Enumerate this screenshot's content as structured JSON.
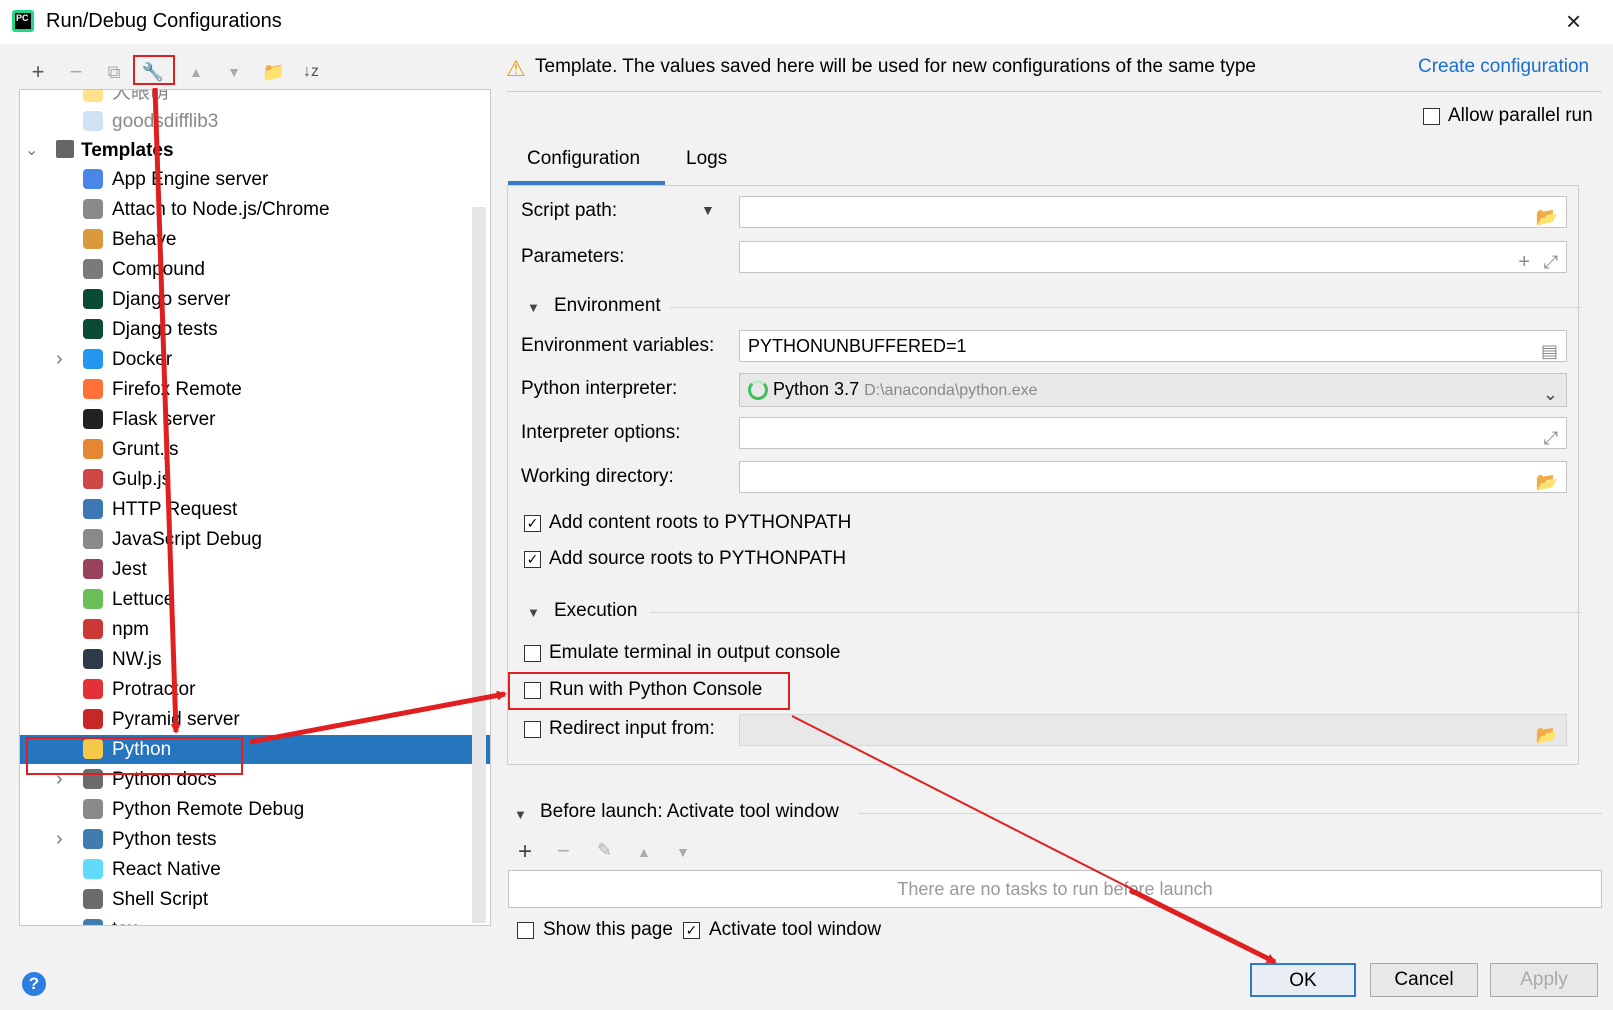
{
  "window": {
    "title": "Run/Debug Configurations",
    "close_icon": "×"
  },
  "left_toolbar": {
    "add": "+",
    "remove": "−",
    "copy": "⧉",
    "edit_defaults": "🔧",
    "move_up": "▲",
    "move_down": "▼",
    "folder": "📁",
    "sort": "↓z"
  },
  "tree": {
    "items_above": [
      "大眼萌",
      "goodsdifflib3"
    ],
    "templates_label": "Templates",
    "items": [
      {
        "label": "App Engine server",
        "color": "#4a86e8"
      },
      {
        "label": "Attach to Node.js/Chrome",
        "color": "#8a8a8a"
      },
      {
        "label": "Behave",
        "color": "#d89a3a"
      },
      {
        "label": "Compound",
        "color": "#7a7a7a"
      },
      {
        "label": "Django server",
        "color": "#0c4b33"
      },
      {
        "label": "Django tests",
        "color": "#0c4b33"
      },
      {
        "label": "Docker",
        "color": "#2496ed",
        "expandable": true
      },
      {
        "label": "Firefox Remote",
        "color": "#ff7139"
      },
      {
        "label": "Flask server",
        "color": "#222222"
      },
      {
        "label": "Grunt.js",
        "color": "#e48632"
      },
      {
        "label": "Gulp.js",
        "color": "#cf4647"
      },
      {
        "label": "HTTP Request",
        "color": "#3c78b4"
      },
      {
        "label": "JavaScript Debug",
        "color": "#8a8a8a"
      },
      {
        "label": "Jest",
        "color": "#99425b"
      },
      {
        "label": "Lettuce",
        "color": "#6bbf59"
      },
      {
        "label": "npm",
        "color": "#cb3837"
      },
      {
        "label": "NW.js",
        "color": "#2f3a4b"
      },
      {
        "label": "Protractor",
        "color": "#e23237"
      },
      {
        "label": "Pyramid server",
        "color": "#c62828"
      },
      {
        "label": "Python",
        "color": "#f7c948",
        "selected": true
      },
      {
        "label": "Python docs",
        "color": "#6b6b6b",
        "expandable": true
      },
      {
        "label": "Python Remote Debug",
        "color": "#8a8a8a"
      },
      {
        "label": "Python tests",
        "color": "#3f7cb0",
        "expandable": true
      },
      {
        "label": "React Native",
        "color": "#61dafb"
      },
      {
        "label": "Shell Script",
        "color": "#6b6b6b"
      },
      {
        "label": "tox",
        "color": "#3f7cb0"
      }
    ]
  },
  "header": {
    "warning_icon": "⚠",
    "notice": "Template. The values saved here will be used for new configurations of the same type",
    "create_link": "Create configuration",
    "allow_parallel": "Allow parallel run"
  },
  "tabs": [
    "Configuration",
    "Logs"
  ],
  "config": {
    "script_path_label": "Script path:",
    "parameters_label": "Parameters:",
    "environment_section": "Environment",
    "env_vars_label": "Environment variables:",
    "env_vars_value": "PYTHONUNBUFFERED=1",
    "interpreter_label": "Python interpreter:",
    "interpreter_name": "Python 3.7",
    "interpreter_path": "D:\\anaconda\\python.exe",
    "interpreter_options_label": "Interpreter options:",
    "working_dir_label": "Working directory:",
    "add_content_roots": "Add content roots to PYTHONPATH",
    "add_source_roots": "Add source roots to PYTHONPATH",
    "execution_section": "Execution",
    "emulate_terminal": "Emulate terminal in output console",
    "run_with_console": "Run with Python Console",
    "redirect_input": "Redirect input from:"
  },
  "before_launch": {
    "title": "Before launch: Activate tool window",
    "empty_text": "There are no tasks to run before launch",
    "show_page": "Show this page",
    "activate_tool_window": "Activate tool window"
  },
  "buttons": {
    "ok": "OK",
    "cancel": "Cancel",
    "apply": "Apply"
  },
  "help": "?",
  "colors": {
    "selection": "#2675bf",
    "link": "#1a6fd1",
    "annotation": "#e02020"
  }
}
